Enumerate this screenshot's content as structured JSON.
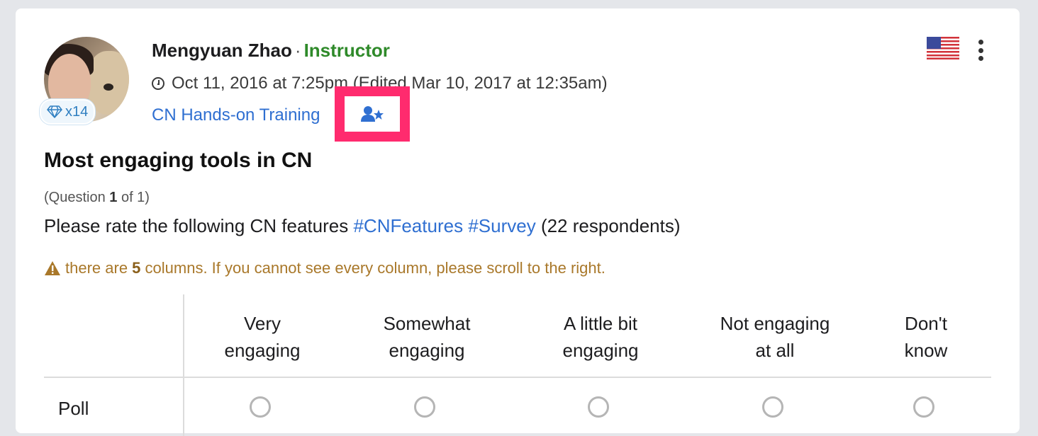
{
  "post": {
    "author": "Mengyuan Zhao",
    "separator": "·",
    "role": "Instructor",
    "badge_count": "x14",
    "timestamp": "Oct 11, 2016 at 7:25pm (Edited Mar 10, 2017 at 12:35am)",
    "course": "CN Hands-on Training",
    "title": "Most engaging tools in CN",
    "question_prefix": "(Question ",
    "question_num": "1",
    "question_suffix": " of 1)",
    "prompt_text": "Please rate the following CN features ",
    "tag1": "#CNFeatures",
    "tag2": "#Survey",
    "respondents": "(22 respondents)",
    "warning_prefix": "there are ",
    "warning_count": "5",
    "warning_suffix": " columns. If you cannot see every column, please scroll to the right."
  },
  "survey": {
    "columns": [
      {
        "line1": "Very",
        "line2": "engaging"
      },
      {
        "line1": "Somewhat",
        "line2": "engaging"
      },
      {
        "line1": "A little bit",
        "line2": "engaging"
      },
      {
        "line1": "Not engaging",
        "line2": "at all"
      },
      {
        "line1": "Don't",
        "line2": "know"
      }
    ],
    "rows": [
      {
        "label": "Poll"
      }
    ]
  },
  "icons": {
    "badge": "diamond-icon",
    "time": "clock-icon",
    "highlight": "user-star-icon",
    "flag": "us-flag-icon",
    "menu": "kebab-menu-icon",
    "warning": "warning-triangle-icon"
  },
  "colors": {
    "accent": "#2f6fd1",
    "role": "#2f8a2a",
    "warning": "#a9782a",
    "highlight": "#ff2b6e"
  }
}
